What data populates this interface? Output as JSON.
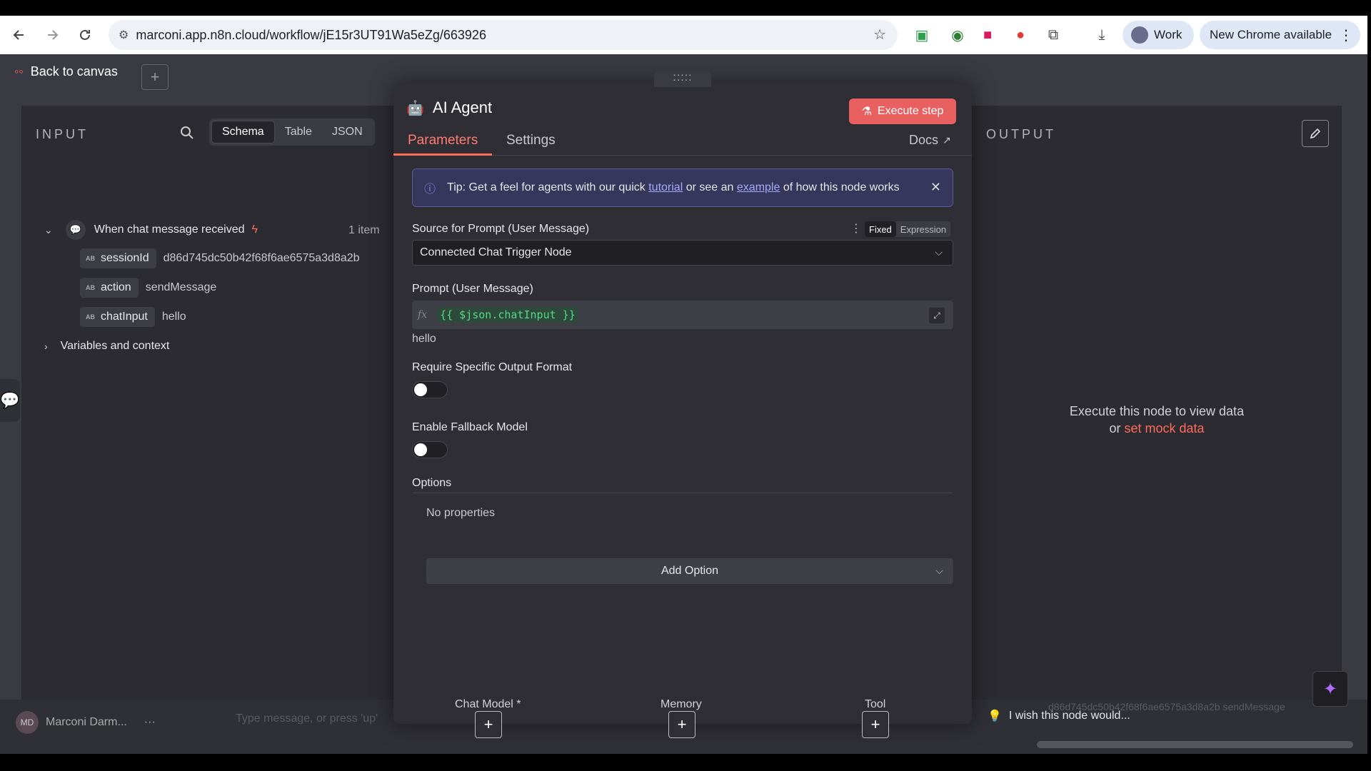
{
  "browser": {
    "url": "marconi.app.n8n.cloud/workflow/jE15r3UT91Wa5eZg/663926",
    "profile": "Work",
    "update_label": "New Chrome available"
  },
  "topbar": {
    "back_label": "Back to canvas"
  },
  "input": {
    "title": "INPUT",
    "views": [
      "Schema",
      "Table",
      "JSON"
    ],
    "trigger_name": "When chat message received",
    "item_count": "1 item",
    "fields": [
      {
        "key": "sessionId",
        "value": "d86d745dc50b42f68f6ae6575a3d8a2b"
      },
      {
        "key": "action",
        "value": "sendMessage"
      },
      {
        "key": "chatInput",
        "value": "hello"
      }
    ],
    "variables_label": "Variables and context"
  },
  "modal": {
    "title": "AI Agent",
    "execute_label": "Execute step",
    "tabs": [
      "Parameters",
      "Settings"
    ],
    "docs_label": "Docs",
    "tip": {
      "prefix": "Tip: Get a feel for agents with our quick",
      "tutorial": "tutorial",
      "middle": "or see an",
      "example": "example",
      "suffix": "of how this node works"
    },
    "source_label": "Source for Prompt (User Message)",
    "mode_fixed": "Fixed",
    "mode_expression": "Expression",
    "source_value": "Connected Chat Trigger Node",
    "prompt_label": "Prompt (User Message)",
    "prompt_expr": "{{ $json.chatInput }}",
    "prompt_result": "hello",
    "require_format_label": "Require Specific Output Format",
    "fallback_label": "Enable Fallback Model",
    "options_label": "Options",
    "no_properties": "No properties",
    "add_option": "Add Option",
    "sub_nodes": [
      "Chat Model *",
      "Memory",
      "Tool"
    ]
  },
  "output": {
    "title": "OUTPUT",
    "msg_line1": "Execute this node to view data",
    "msg_or": "or",
    "mock_link": "set mock data"
  },
  "bottom": {
    "user_initials": "MD",
    "user_name": "Marconi Darm...",
    "chat_placeholder": "Type message, or press 'up'",
    "wish_text": "I wish this node would...",
    "ghost_values": "d86d745dc50b42f68f6ae6575a3d8a2b   sendMessage"
  },
  "colors": {
    "accent": "#ff6d5a",
    "panel_bg": "#2b2b31",
    "modal_bg": "#2e2e34",
    "tip_bg": "#36375a"
  }
}
